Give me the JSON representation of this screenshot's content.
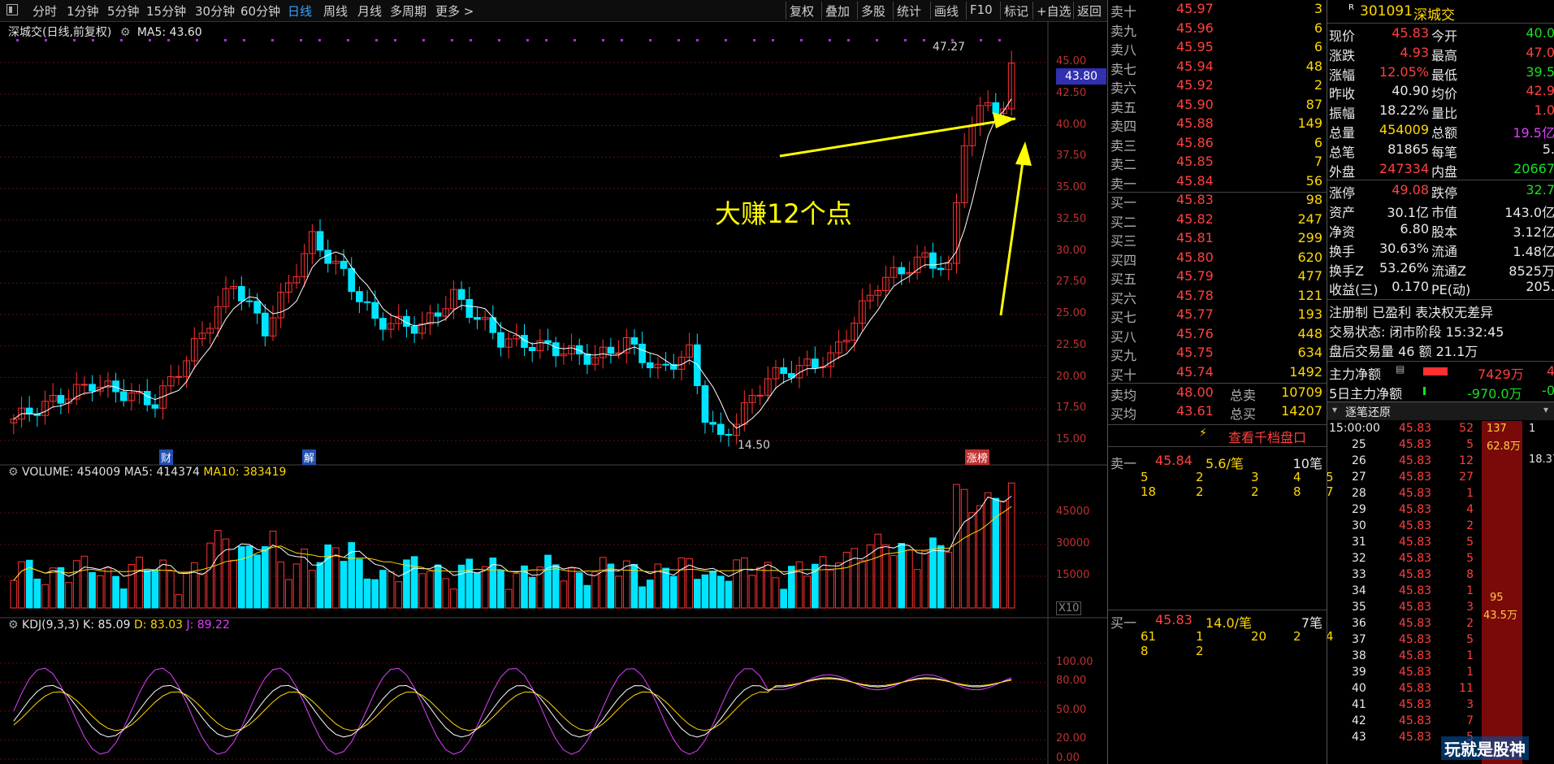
{
  "toolbar": {
    "left_items": [
      "分时",
      "1分钟",
      "5分钟",
      "15分钟",
      "30分钟",
      "60分钟",
      "日线",
      "周线",
      "月线",
      "多周期",
      "更多 >"
    ],
    "active": "日线",
    "right_items": [
      "复权",
      "叠加",
      "多股",
      "统计",
      "画线",
      "F10",
      "标记",
      "+自选",
      "返回"
    ]
  },
  "chart": {
    "title": "深城交(日线,前复权)",
    "ma_label": "MA5: 43.60",
    "current_price_tag": "43.80",
    "high_label": "47.27",
    "low_label": "14.50",
    "annotation": "大赚12个点",
    "markers": [
      "财",
      "解",
      "涨榜"
    ],
    "price_axis": [
      "45.00",
      "42.50",
      "40.00",
      "37.50",
      "35.00",
      "32.50",
      "30.00",
      "27.50",
      "25.00",
      "22.50",
      "20.00",
      "17.50",
      "15.00"
    ],
    "volume_header": {
      "vol": "VOLUME: 454009",
      "ma5": "MA5: 414374",
      "ma10": "MA10: 383419"
    },
    "volume_axis": [
      "45000",
      "30000",
      "15000"
    ],
    "x10_label": "X10",
    "kdj_header": {
      "name": "KDJ(9,3,3)",
      "k": "K: 85.09",
      "d": "D: 83.03",
      "j": "J: 89.22"
    },
    "kdj_axis": [
      "100.00",
      "80.00",
      "50.00",
      "20.00",
      "0.00"
    ],
    "colors": {
      "up": "#ff3232",
      "down": "#00e5ff",
      "ma": "#ffffff",
      "ma10": "#ffd800",
      "j": "#e040ff",
      "arrow": "#ffff00"
    }
  },
  "orderbook": {
    "asks": [
      {
        "label": "卖十",
        "price": "45.97",
        "vol": "3"
      },
      {
        "label": "卖九",
        "price": "45.96",
        "vol": "6"
      },
      {
        "label": "卖八",
        "price": "45.95",
        "vol": "6"
      },
      {
        "label": "卖七",
        "price": "45.94",
        "vol": "48"
      },
      {
        "label": "卖六",
        "price": "45.92",
        "vol": "2"
      },
      {
        "label": "卖五",
        "price": "45.90",
        "vol": "87"
      },
      {
        "label": "卖四",
        "price": "45.88",
        "vol": "149"
      },
      {
        "label": "卖三",
        "price": "45.86",
        "vol": "6"
      },
      {
        "label": "卖二",
        "price": "45.85",
        "vol": "7"
      },
      {
        "label": "卖一",
        "price": "45.84",
        "vol": "56"
      }
    ],
    "bids": [
      {
        "label": "买一",
        "price": "45.83",
        "vol": "98"
      },
      {
        "label": "买二",
        "price": "45.82",
        "vol": "247"
      },
      {
        "label": "买三",
        "price": "45.81",
        "vol": "299"
      },
      {
        "label": "买四",
        "price": "45.80",
        "vol": "620"
      },
      {
        "label": "买五",
        "price": "45.79",
        "vol": "477"
      },
      {
        "label": "买六",
        "price": "45.78",
        "vol": "121"
      },
      {
        "label": "买七",
        "price": "45.77",
        "vol": "193"
      },
      {
        "label": "买八",
        "price": "45.76",
        "vol": "448"
      },
      {
        "label": "买九",
        "price": "45.75",
        "vol": "634"
      },
      {
        "label": "买十",
        "price": "45.74",
        "vol": "1492"
      }
    ],
    "avg_sell": {
      "label": "卖均",
      "price": "48.00",
      "tlabel": "总卖",
      "total": "10709"
    },
    "avg_buy": {
      "label": "买均",
      "price": "43.61",
      "tlabel": "总买",
      "total": "14207"
    },
    "view_link": "查看千档盘口",
    "sell1": {
      "label": "卖一",
      "price": "45.84",
      "per": "5.6/笔",
      "count": "10笔",
      "q1": [
        "5",
        "2",
        "3",
        "4",
        "5"
      ],
      "q2": [
        "18",
        "2",
        "2",
        "8",
        "7"
      ]
    },
    "buy1": {
      "label": "买一",
      "price": "45.83",
      "per": "14.0/笔",
      "count": "7笔",
      "q1": [
        "61",
        "1",
        "20",
        "2",
        "4"
      ],
      "q2": [
        "8",
        "2"
      ]
    }
  },
  "quote": {
    "badge": "R",
    "code": "301091",
    "name": "深城交",
    "stats": [
      {
        "l1": "现价",
        "v1": "45.83",
        "c1": "red",
        "l2": "今开",
        "v2": "40.0",
        "c2": "green"
      },
      {
        "l1": "涨跌",
        "v1": "4.93",
        "c1": "red",
        "l2": "最高",
        "v2": "47.0",
        "c2": "red"
      },
      {
        "l1": "涨幅",
        "v1": "12.05%",
        "c1": "red",
        "l2": "最低",
        "v2": "39.5",
        "c2": "green"
      },
      {
        "l1": "昨收",
        "v1": "40.90",
        "c1": "white",
        "l2": "均价",
        "v2": "42.9",
        "c2": "red"
      },
      {
        "l1": "振幅",
        "v1": "18.22%",
        "c1": "white",
        "l2": "量比",
        "v2": "1.0",
        "c2": "red"
      },
      {
        "l1": "总量",
        "v1": "454009",
        "c1": "yellow",
        "l2": "总额",
        "v2": "19.5亿",
        "c2": "purple"
      },
      {
        "l1": "总笔",
        "v1": "81865",
        "c1": "white",
        "l2": "每笔",
        "v2": "5.",
        "c2": "white"
      },
      {
        "l1": "外盘",
        "v1": "247334",
        "c1": "red",
        "l2": "内盘",
        "v2": "20667",
        "c2": "green"
      },
      {
        "l1": "涨停",
        "v1": "49.08",
        "c1": "red",
        "l2": "跌停",
        "v2": "32.7",
        "c2": "green"
      },
      {
        "l1": "资产",
        "v1": "30.1亿",
        "c1": "white",
        "l2": "市值",
        "v2": "143.0亿",
        "c2": "white"
      },
      {
        "l1": "净资",
        "v1": "6.80",
        "c1": "white",
        "l2": "股本",
        "v2": "3.12亿",
        "c2": "white"
      },
      {
        "l1": "换手",
        "v1": "30.63%",
        "c1": "white",
        "l2": "流通",
        "v2": "1.48亿",
        "c2": "white"
      },
      {
        "l1": "换手Z",
        "v1": "53.26%",
        "c1": "white",
        "l2": "流通Z",
        "v2": "8525万",
        "c2": "white"
      },
      {
        "l1": "收益(三)",
        "v1": "0.170",
        "c1": "white",
        "l2": "PE(动)",
        "v2": "205.",
        "c2": "white"
      }
    ],
    "reg_line": "注册制 已盈利 表决权无差异",
    "trade_status": "交易状态: 闭市阶段 15:32:45",
    "after_hours": "盘后交易量 46 额 21.1万",
    "main_net_label": "主力净额",
    "main_net": "7429万",
    "main_net_tail": "4",
    "five_day_label": "5日主力净额",
    "five_day": "-970.0万",
    "five_day_tail": "-0",
    "tick_title": "逐笔还原",
    "ticks": [
      {
        "t": "15:00:00",
        "p": "45.83",
        "v": "52"
      },
      {
        "t": "25",
        "p": "45.83",
        "v": "5"
      },
      {
        "t": "26",
        "p": "45.83",
        "v": "12"
      },
      {
        "t": "27",
        "p": "45.83",
        "v": "27"
      },
      {
        "t": "28",
        "p": "45.83",
        "v": "1"
      },
      {
        "t": "29",
        "p": "45.83",
        "v": "4"
      },
      {
        "t": "30",
        "p": "45.83",
        "v": "2"
      },
      {
        "t": "31",
        "p": "45.83",
        "v": "5"
      },
      {
        "t": "32",
        "p": "45.83",
        "v": "5"
      },
      {
        "t": "33",
        "p": "45.83",
        "v": "8"
      },
      {
        "t": "34",
        "p": "45.83",
        "v": "1"
      },
      {
        "t": "35",
        "p": "45.83",
        "v": "3"
      },
      {
        "t": "36",
        "p": "45.83",
        "v": "2"
      },
      {
        "t": "37",
        "p": "45.83",
        "v": "5"
      },
      {
        "t": "38",
        "p": "45.83",
        "v": "1"
      },
      {
        "t": "39",
        "p": "45.83",
        "v": "1"
      },
      {
        "t": "40",
        "p": "45.83",
        "v": "11"
      },
      {
        "t": "41",
        "p": "45.83",
        "v": "3"
      },
      {
        "t": "42",
        "p": "45.83",
        "v": "7"
      },
      {
        "t": "43",
        "p": "45.83",
        "v": "5"
      }
    ],
    "tick_bar_labels": {
      "top_count": "137",
      "top_amt": "62.8万",
      "mid_count": "95",
      "mid_amt": "43.5万",
      "side1": "1",
      "side2": "18.37"
    },
    "watermark": "玩就是股神"
  }
}
